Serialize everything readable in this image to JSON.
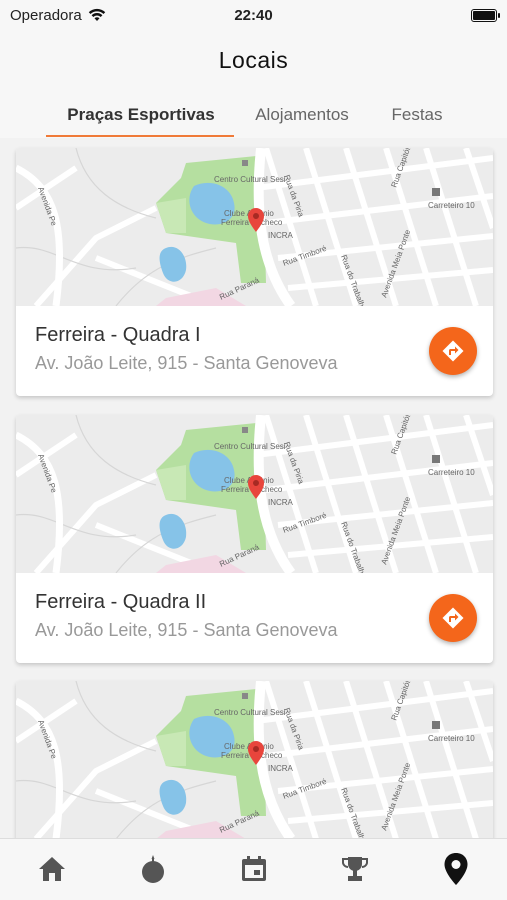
{
  "status": {
    "carrier": "Operadora",
    "time": "22:40"
  },
  "header": {
    "title": "Locais",
    "tabs": [
      {
        "label": "Praças Esportivas",
        "active": true
      },
      {
        "label": "Alojamentos",
        "active": false
      },
      {
        "label": "Festas",
        "active": false
      }
    ]
  },
  "map_labels": {
    "cultural": "Centro Cultural Sesi",
    "club_line1": "Clube Antônio",
    "club_line2": "Ferreira Pacheco",
    "incra": "INCRA",
    "rua_timbore": "Rua Timboré",
    "rua_parana": "Rua Paraná",
    "rua_piria": "Rua da Piria",
    "rua_capitolio": "Rua Capitólio",
    "av_meia_ponte": "Avenida Meia Ponte",
    "rua_trabalho": "Rua do Trabalho",
    "carreteiro": "Carreteiro 10",
    "av_pe": "Avenida Pe"
  },
  "places": [
    {
      "name": "Ferreira - Quadra I",
      "address": "Av. João Leite, 915 - Santa Genoveva"
    },
    {
      "name": "Ferreira - Quadra II",
      "address": "Av. João Leite, 915 - Santa Genoveva"
    },
    {
      "name": "",
      "address": ""
    }
  ],
  "nav": [
    {
      "icon": "home-icon",
      "active": false
    },
    {
      "icon": "sports-ball-icon",
      "active": false
    },
    {
      "icon": "calendar-icon",
      "active": false
    },
    {
      "icon": "trophy-icon",
      "active": false
    },
    {
      "icon": "location-pin-icon",
      "active": true
    }
  ],
  "colors": {
    "accent": "#f4661b",
    "tab_indicator": "#f07a38",
    "park_green": "#b5dfa0",
    "water_blue": "#86c3e8",
    "map_bg": "#ececec",
    "pin_red": "#e8453c"
  }
}
